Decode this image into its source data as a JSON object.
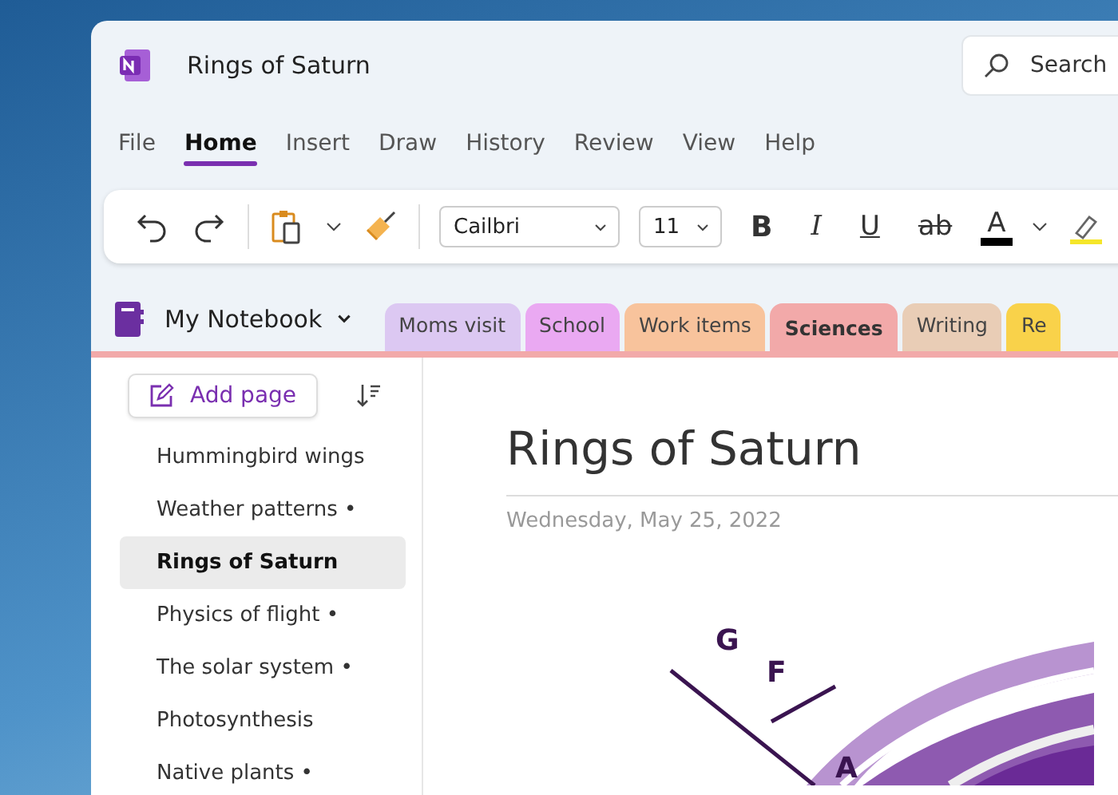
{
  "window": {
    "title": "Rings of Saturn"
  },
  "search": {
    "placeholder": "Search"
  },
  "menu": [
    {
      "label": "File",
      "selected": false
    },
    {
      "label": "Home",
      "selected": true
    },
    {
      "label": "Insert",
      "selected": false
    },
    {
      "label": "Draw",
      "selected": false
    },
    {
      "label": "History",
      "selected": false
    },
    {
      "label": "Review",
      "selected": false
    },
    {
      "label": "View",
      "selected": false
    },
    {
      "label": "Help",
      "selected": false
    }
  ],
  "toolbar": {
    "font": "Cailbri",
    "size": "11",
    "format_buttons": [
      {
        "label": "B",
        "kind": "bold"
      },
      {
        "label": "I",
        "kind": "italic"
      },
      {
        "label": "U",
        "kind": "underline"
      },
      {
        "label": "ab",
        "kind": "strike"
      },
      {
        "label": "A",
        "kind": "color"
      }
    ]
  },
  "notebook": {
    "name": "My Notebook"
  },
  "sections": [
    {
      "label": "Moms visit",
      "color": "#dcc8f2",
      "selected": false
    },
    {
      "label": "School",
      "color": "#eaa9f2",
      "selected": false
    },
    {
      "label": "Work items",
      "color": "#f8c39c",
      "selected": false
    },
    {
      "label": "Sciences",
      "color": "#f2a9a9",
      "selected": true
    },
    {
      "label": "Writing",
      "color": "#e9cdb6",
      "selected": false
    },
    {
      "label": "Re",
      "color": "#f9d24a",
      "selected": false
    }
  ],
  "add_page": {
    "label": "Add page"
  },
  "pages": [
    {
      "label": "Hummingbird wings",
      "selected": false
    },
    {
      "label": "Weather patterns •",
      "selected": false
    },
    {
      "label": "Rings of Saturn",
      "selected": true
    },
    {
      "label": "Physics of flight •",
      "selected": false
    },
    {
      "label": "The solar system •",
      "selected": false
    },
    {
      "label": "Photosynthesis",
      "selected": false
    },
    {
      "label": "Native plants •",
      "selected": false
    }
  ],
  "page": {
    "title": "Rings of Saturn",
    "date": "Wednesday, May 25, 2022",
    "drawing_labels": [
      "G",
      "F",
      "A"
    ]
  }
}
